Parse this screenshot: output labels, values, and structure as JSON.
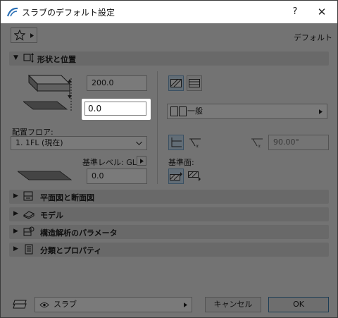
{
  "window": {
    "title": "スラブのデフォルト設定",
    "help_label": "?",
    "close_label": "✕"
  },
  "toolbar": {
    "favorites_icon": "star-icon",
    "default_label": "デフォルト"
  },
  "sections": {
    "shape_position": {
      "label": "形状と位置",
      "expanded": true
    },
    "plan_section": {
      "label": "平面図と断面図"
    },
    "model": {
      "label": "モデル"
    },
    "structural": {
      "label": "構造解析のパラメータ"
    },
    "classification": {
      "label": "分類とプロパティ"
    }
  },
  "geometry": {
    "thickness": "200.0",
    "offset": "0.0",
    "placement_floor_label": "配置フロア:",
    "placement_floor_value": "1. 1FL (現在)",
    "reference_level_label": "基準レベル: GL",
    "reference_level_value": "0.0",
    "composite_label": "一般",
    "angle_value": "90.00°",
    "reference_plane_label": "基準面:"
  },
  "footer": {
    "layer_label": "スラブ",
    "cancel_label": "キャンセル",
    "ok_label": "OK"
  },
  "colors": {
    "dim_overlay": "#000000",
    "section_bg": "#dcdcdc",
    "selected_icon": "#cce4f7"
  }
}
